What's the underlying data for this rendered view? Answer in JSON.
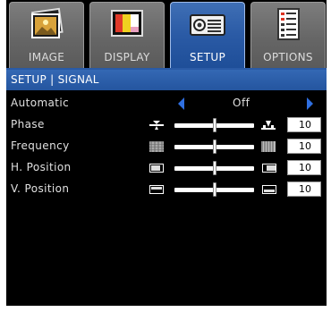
{
  "tabs": [
    {
      "label": "IMAGE",
      "icon": "image-icon",
      "active": false
    },
    {
      "label": "DISPLAY",
      "icon": "display-icon",
      "active": false
    },
    {
      "label": "SETUP",
      "icon": "setup-projector-icon",
      "active": true
    },
    {
      "label": "OPTIONS",
      "icon": "options-checklist-icon",
      "active": false
    }
  ],
  "breadcrumb": "SETUP | SIGNAL",
  "rows": {
    "automatic": {
      "label": "Automatic",
      "value": "Off"
    },
    "phase": {
      "label": "Phase",
      "value": "10",
      "level": 0.5
    },
    "frequency": {
      "label": "Frequency",
      "value": "10",
      "level": 0.5
    },
    "h_position": {
      "label": "H. Position",
      "value": "10",
      "level": 0.5
    },
    "v_position": {
      "label": "V. Position",
      "value": "10",
      "level": 0.5
    }
  },
  "colors": {
    "accent": "#2a5aa5",
    "arrow": "#2f6fe0",
    "background": "#000000"
  }
}
